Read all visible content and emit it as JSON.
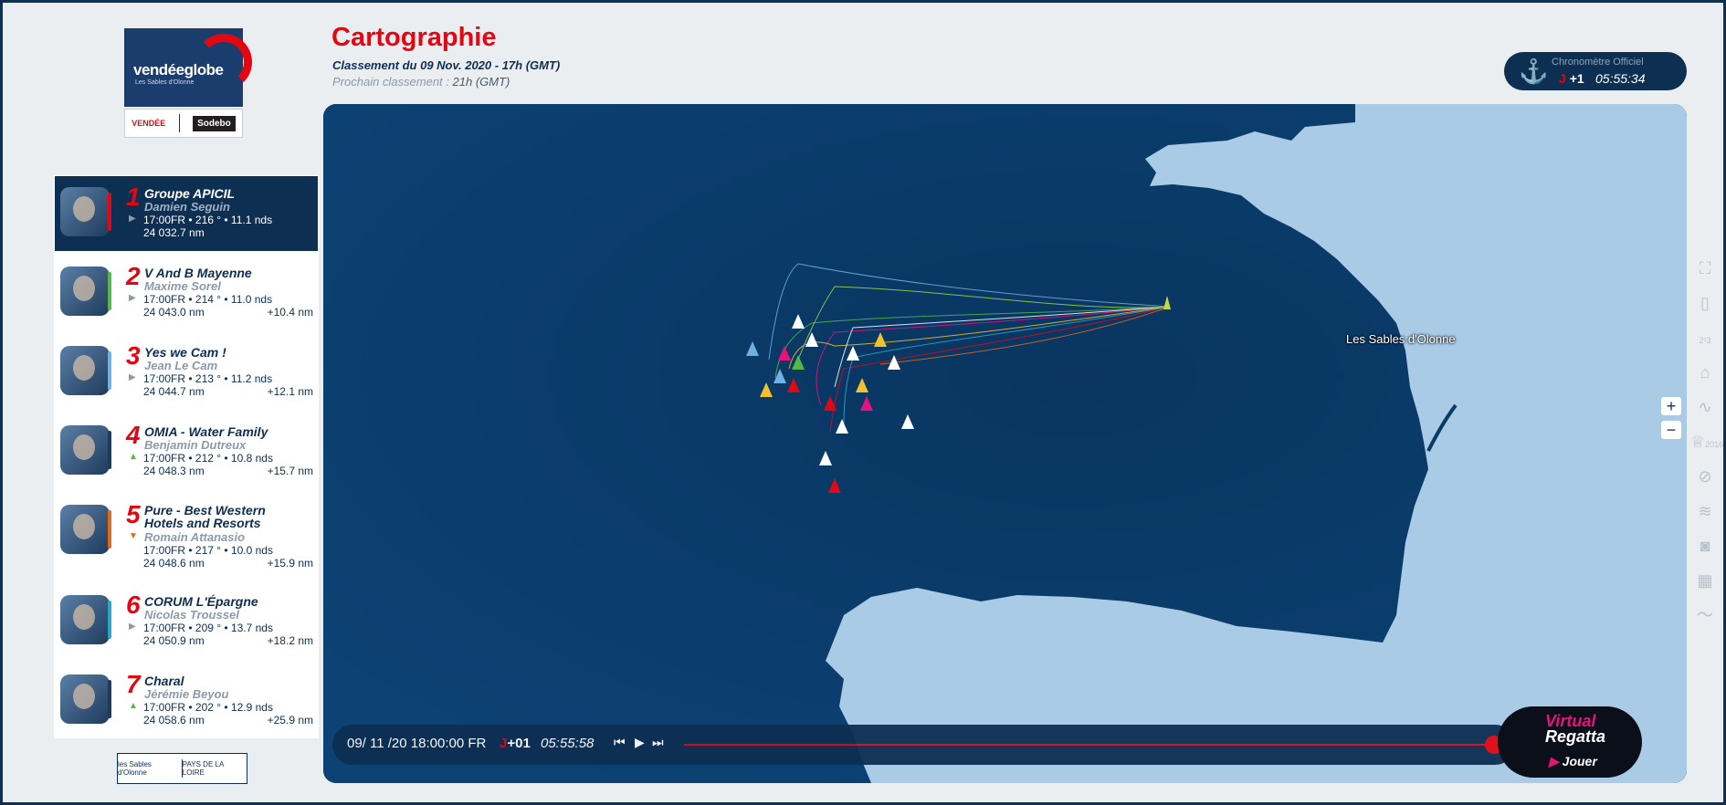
{
  "header": {
    "title": "Cartographie",
    "rank_line": "Classement du 09 Nov. 2020 - 17h (GMT)",
    "next_label": "Prochain classement :",
    "next_value": "21h (GMT)"
  },
  "logo": {
    "brand": "vendéeglobe",
    "sub": "Les Sables d'Olonne",
    "sponsor_left": "VENDÉE",
    "sponsor_right": "Sodebo"
  },
  "chrono": {
    "label": "Chronomètre Officiel",
    "j": "J",
    "day": "+1",
    "time": "05:55:34"
  },
  "ranking": [
    {
      "rank": "1",
      "boat": "Groupe APICIL",
      "skipper": "Damien Seguin",
      "stats": "17:00FR • 216 ° • 11.1 nds",
      "dist": "24 032.7 nm",
      "gap": "",
      "trend": "flat",
      "color": "#e30613"
    },
    {
      "rank": "2",
      "boat": "V And B Mayenne",
      "skipper": "Maxime Sorel",
      "stats": "17:00FR • 214 ° • 11.0 nds",
      "dist": "24 043.0 nm",
      "gap": "+10.4 nm",
      "trend": "flat",
      "color": "#53b848"
    },
    {
      "rank": "3",
      "boat": "Yes we Cam !",
      "skipper": "Jean Le Cam",
      "stats": "17:00FR • 213 ° • 11.2 nds",
      "dist": "24 044.7 nm",
      "gap": "+12.1 nm",
      "trend": "flat",
      "color": "#6fb1e3"
    },
    {
      "rank": "4",
      "boat": "OMIA - Water Family",
      "skipper": "Benjamin Dutreux",
      "stats": "17:00FR • 212 ° • 10.8 nds",
      "dist": "24 048.3 nm",
      "gap": "+15.7 nm",
      "trend": "up",
      "color": "#1e3b5c"
    },
    {
      "rank": "5",
      "boat": "Pure - Best Western Hotels and Resorts",
      "skipper": "Romain Attanasio",
      "stats": "17:00FR • 217 ° • 10.0 nds",
      "dist": "24 048.6 nm",
      "gap": "+15.9 nm",
      "trend": "down",
      "color": "#e06a1c"
    },
    {
      "rank": "6",
      "boat": "CORUM L'Épargne",
      "skipper": "Nicolas Troussel",
      "stats": "17:00FR • 209 ° • 13.7 nds",
      "dist": "24 050.9 nm",
      "gap": "+18.2 nm",
      "trend": "flat",
      "color": "#2aa6c9"
    },
    {
      "rank": "7",
      "boat": "Charal",
      "skipper": "Jérémie Beyou",
      "stats": "17:00FR • 202 ° • 12.9 nds",
      "dist": "24 058.6 nm",
      "gap": "+25.9 nm",
      "trend": "up",
      "color": "#1e3b5c"
    }
  ],
  "footer_logo": {
    "left": "les Sables d'Olonne",
    "right": "PAYS DE LA LOIRE"
  },
  "map": {
    "city_label": "Les Sables d'Olonne"
  },
  "timeline": {
    "date": "09/ 11 /20  18:00:00 FR",
    "j": "J",
    "day": "+01",
    "time": "05:55:58",
    "rewind_icon": "⏮",
    "play_icon": "▶",
    "forward_icon": "⏭"
  },
  "regatta": {
    "line1": "Virtual",
    "line2": "Regatta",
    "play": "Jouer"
  },
  "zoom": {
    "plus": "+",
    "minus": "−"
  },
  "tools": [
    {
      "name": "fullscreen-icon",
      "glyph": "⛶"
    },
    {
      "name": "map-layer-icon",
      "glyph": "▯"
    },
    {
      "name": "ranking-icon",
      "glyph": "2¹3"
    },
    {
      "name": "tag-icon",
      "glyph": "⌂"
    },
    {
      "name": "route-icon",
      "glyph": "∿"
    },
    {
      "name": "trophy-2016-icon",
      "glyph": "♕",
      "label": "2016"
    },
    {
      "name": "compass-icon",
      "glyph": "⊘"
    },
    {
      "name": "wind-icon",
      "glyph": "≋"
    },
    {
      "name": "camera-icon",
      "glyph": "◙"
    },
    {
      "name": "grid-icon",
      "glyph": "▦"
    },
    {
      "name": "wave-icon",
      "glyph": "〜"
    }
  ]
}
